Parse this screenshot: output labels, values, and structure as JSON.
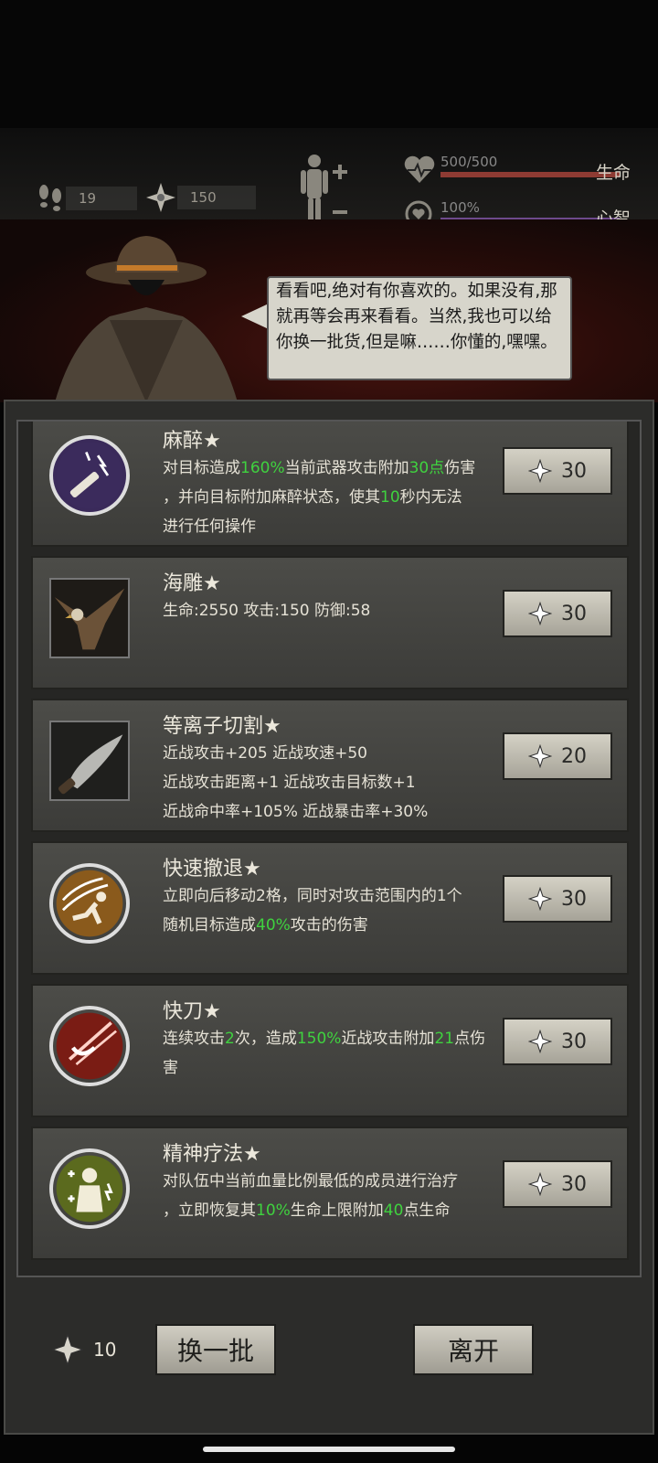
{
  "status": {
    "steps_value": "19",
    "currency_value": "150",
    "hp_value": "500/500",
    "hp_label": "生命",
    "sanity_value": "100%",
    "sanity_label": "心智"
  },
  "merchant": {
    "dialogue": "看看吧,绝对有你喜欢的。如果没有,那就再等会再来看看。当然,我也可以给你换一批货,但是嘛……你懂的,嘿嘿。"
  },
  "items": [
    {
      "title": "麻醉★",
      "desc": [
        [
          {
            "t": "对目标造成"
          },
          {
            "t": "160%",
            "g": true
          },
          {
            "t": "当前武器攻击附加"
          },
          {
            "t": "30点",
            "g": true
          },
          {
            "t": "伤害"
          }
        ],
        [
          {
            "t": "，并向目标附加麻醉状态，使其"
          },
          {
            "t": "10",
            "g": true
          },
          {
            "t": "秒内无法"
          }
        ],
        [
          {
            "t": "进行任何操作"
          }
        ]
      ],
      "price": "30"
    },
    {
      "title": "海雕★",
      "desc": [
        [
          {
            "t": "生命:2550  攻击:150  防御:58"
          }
        ]
      ],
      "price": "30"
    },
    {
      "title": "等离子切割★",
      "desc": [
        [
          {
            "t": "近战攻击+205  近战攻速+50"
          }
        ],
        [
          {
            "t": "近战攻击距离+1  近战攻击目标数+1"
          }
        ],
        [
          {
            "t": "近战命中率+105%  近战暴击率+30%"
          }
        ]
      ],
      "price": "20"
    },
    {
      "title": "快速撤退★",
      "desc": [
        [
          {
            "t": "立即向后移动2格，同时对攻击范围内的1个"
          }
        ],
        [
          {
            "t": "随机目标造成"
          },
          {
            "t": "40%",
            "g": true
          },
          {
            "t": "攻击的伤害"
          }
        ]
      ],
      "price": "30"
    },
    {
      "title": "快刀★",
      "desc": [
        [
          {
            "t": "连续攻击"
          },
          {
            "t": "2",
            "g": true
          },
          {
            "t": "次，造成"
          },
          {
            "t": "150%",
            "g": true
          },
          {
            "t": "近战攻击附加"
          },
          {
            "t": "21",
            "g": true
          },
          {
            "t": "点伤"
          }
        ],
        [
          {
            "t": "害"
          }
        ]
      ],
      "price": "30"
    },
    {
      "title": "精神疗法★",
      "desc": [
        [
          {
            "t": "对队伍中当前血量比例最低的成员进行治疗"
          }
        ],
        [
          {
            "t": "，立即恢复其"
          },
          {
            "t": "10%",
            "g": true
          },
          {
            "t": "生命上限附加"
          },
          {
            "t": "40",
            "g": true
          },
          {
            "t": "点生命"
          }
        ]
      ],
      "price": "30"
    }
  ],
  "footer": {
    "refresh_cost": "10",
    "refresh_label": "换一批",
    "leave_label": "离开"
  },
  "colors": {
    "highlight_green": "#3fd23f",
    "hp_bar": "#8e3b33",
    "sanity_bar": "#6e4a8c"
  }
}
